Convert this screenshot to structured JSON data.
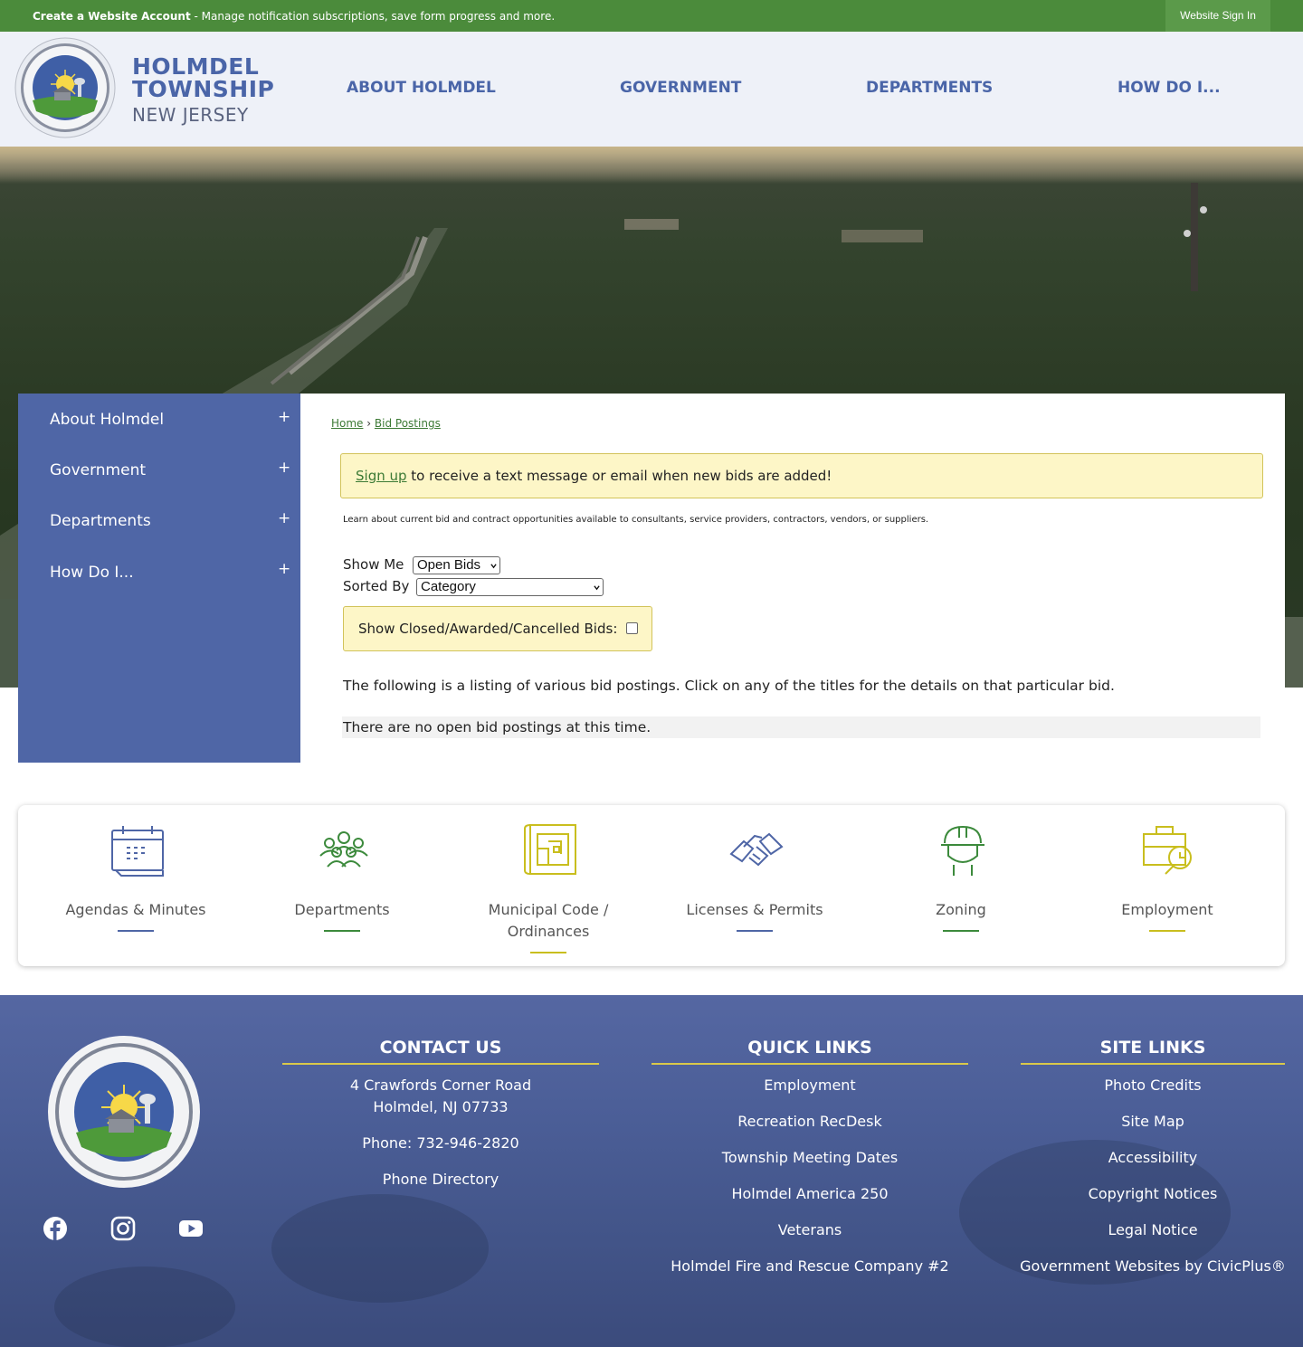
{
  "top_banner": {
    "create_label": "Create a Website Account",
    "message": " - Manage notification subscriptions, save form progress and more.",
    "signin_label": "Website Sign In"
  },
  "header": {
    "brand_line1": "HOLMDEL",
    "brand_line2": "TOWNSHIP",
    "brand_line3": "NEW JERSEY",
    "nav": [
      "ABOUT HOLMDEL",
      "GOVERNMENT",
      "DEPARTMENTS",
      "HOW DO I..."
    ]
  },
  "sidebar": {
    "items": [
      {
        "label": "About Holmdel",
        "toggle": "+"
      },
      {
        "label": "Government",
        "toggle": "+"
      },
      {
        "label": "Departments",
        "toggle": "+"
      },
      {
        "label": "How Do I...",
        "toggle": "+"
      }
    ]
  },
  "main": {
    "breadcrumb": {
      "home": "Home",
      "separator": "›",
      "current": "Bid Postings"
    },
    "signup": {
      "link": "Sign up",
      "text": " to receive a text message or email when new bids are added!"
    },
    "learn_text": "Learn about current bid and contract opportunities available to consultants, service providers, contractors, vendors, or suppliers.",
    "show_me": {
      "label": "Show Me",
      "value": "Open Bids"
    },
    "sorted_by": {
      "label": "Sorted By",
      "value": "Category"
    },
    "closed_label": "Show Closed/Awarded/Cancelled Bids:",
    "closed_checked": false,
    "listing_text": "The following is a listing of various bid postings. Click on any of the titles for the details on that particular bid.",
    "no_bids_text": "There are no open bid postings at this time."
  },
  "quick_links": [
    {
      "label": "Agendas & Minutes",
      "icon": "calendar-icon",
      "color": "#4f66a6"
    },
    {
      "label": "Departments",
      "icon": "people-group-icon",
      "color": "#3c8a3c"
    },
    {
      "label": "Municipal Code / Ordinances",
      "label_line1": "Municipal Code /",
      "label_line2": "Ordinances",
      "icon": "blueprint-icon",
      "color": "#c9be1e"
    },
    {
      "label": "Licenses & Permits",
      "icon": "handshake-icon",
      "color": "#4f66a6"
    },
    {
      "label": "Zoning",
      "icon": "hard-hat-worker-icon",
      "color": "#3c8a3c"
    },
    {
      "label": "Employment",
      "icon": "briefcase-search-icon",
      "color": "#c9be1e"
    }
  ],
  "footer": {
    "contact": {
      "heading": "CONTACT US",
      "address1": "4 Crawfords Corner Road",
      "address2": "Holmdel, NJ  07733",
      "phone": "Phone: 732-946-2820",
      "directory": "Phone Directory"
    },
    "quick": {
      "heading": "QUICK LINKS",
      "links": [
        "Employment",
        "Recreation RecDesk",
        "Township Meeting Dates",
        "Holmdel America 250",
        "Veterans",
        "Holmdel Fire and Rescue Company #2"
      ]
    },
    "site": {
      "heading": "SITE LINKS",
      "links": [
        "Photo Credits",
        "Site Map",
        "Accessibility",
        "Copyright Notices",
        "Legal Notice",
        "Government Websites by CivicPlus®"
      ]
    },
    "social": [
      "facebook-icon",
      "instagram-icon",
      "youtube-icon"
    ]
  },
  "colors": {
    "banner_green": "#4b8b3b",
    "brand_blue": "#4a65a8",
    "sidebar_blue": "#4f66a6",
    "accent_yellow": "#d9c94a",
    "link_green": "#3c7a35"
  }
}
